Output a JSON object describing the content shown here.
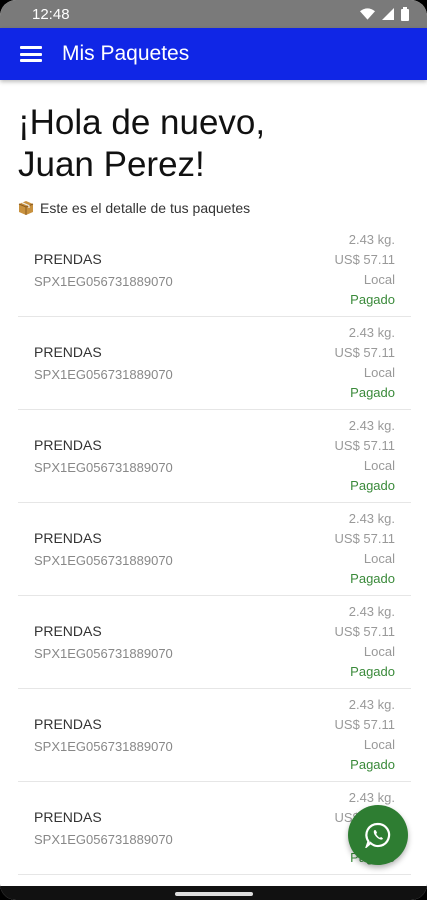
{
  "status_bar": {
    "time": "12:48"
  },
  "app_bar": {
    "title": "Mis Paquetes"
  },
  "greeting": {
    "line1": "¡Hola de nuevo,",
    "line2": "Juan Perez!"
  },
  "subtitle": "Este es el detalle de tus paquetes",
  "packages": [
    {
      "name": "PRENDAS",
      "code": "SPX1EG056731889070",
      "weight": "2.43 kg.",
      "price": "US$ 57.11",
      "type": "Local",
      "status": "Pagado"
    },
    {
      "name": "PRENDAS",
      "code": "SPX1EG056731889070",
      "weight": "2.43 kg.",
      "price": "US$ 57.11",
      "type": "Local",
      "status": "Pagado"
    },
    {
      "name": "PRENDAS",
      "code": "SPX1EG056731889070",
      "weight": "2.43 kg.",
      "price": "US$ 57.11",
      "type": "Local",
      "status": "Pagado"
    },
    {
      "name": "PRENDAS",
      "code": "SPX1EG056731889070",
      "weight": "2.43 kg.",
      "price": "US$ 57.11",
      "type": "Local",
      "status": "Pagado"
    },
    {
      "name": "PRENDAS",
      "code": "SPX1EG056731889070",
      "weight": "2.43 kg.",
      "price": "US$ 57.11",
      "type": "Local",
      "status": "Pagado"
    },
    {
      "name": "PRENDAS",
      "code": "SPX1EG056731889070",
      "weight": "2.43 kg.",
      "price": "US$ 57.11",
      "type": "Local",
      "status": "Pagado"
    },
    {
      "name": "PRENDAS",
      "code": "SPX1EG056731889070",
      "weight": "2.43 kg.",
      "price": "US$ 57.11",
      "type": "Local",
      "status": "Pagado"
    }
  ],
  "icons": {
    "menu": "hamburger-menu-icon",
    "package": "package-box-icon",
    "whatsapp": "whatsapp-icon",
    "wifi": "wifi-icon",
    "signal": "cell-signal-icon",
    "battery": "battery-icon"
  },
  "colors": {
    "app_bar": "#1026e6",
    "status_paid": "#3a8a3a",
    "fab": "#2e7d32"
  }
}
